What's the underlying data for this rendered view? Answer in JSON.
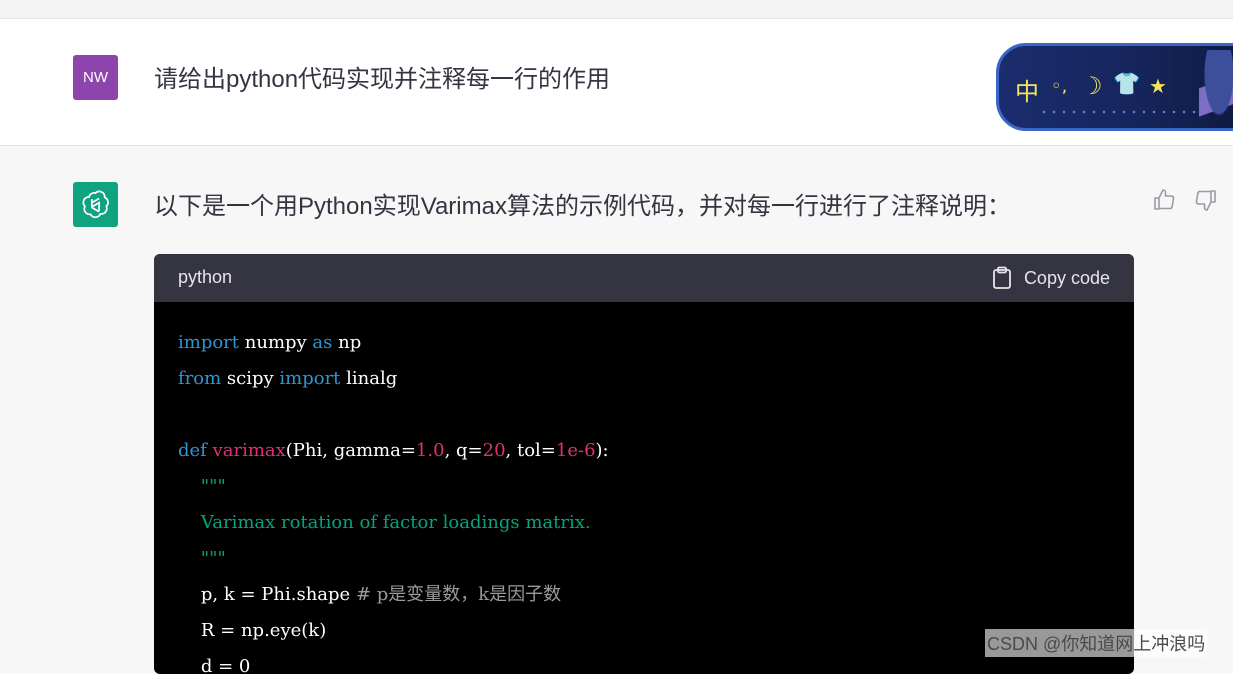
{
  "user_message": {
    "avatar_initials": "NW",
    "text": "请给出python代码实现并注释每一行的作用"
  },
  "ime_toolbar": {
    "items": [
      "中",
      "◦,",
      "☽",
      "👕",
      "★"
    ]
  },
  "assistant_message": {
    "text": "以下是一个用Python实现Varimax算法的示例代码，并对每一行进行了注释说明："
  },
  "code_block": {
    "language": "python",
    "copy_label": "Copy code",
    "tokens": {
      "import": "import",
      "numpy": " numpy ",
      "as": "as",
      "np": " np",
      "from": "from",
      "scipy": " scipy ",
      "import2": "import",
      "linalg": " linalg",
      "def": "def",
      "varimax": " varimax",
      "sig1": "(Phi, gamma=",
      "v1": "1.0",
      "sig2": ", q=",
      "v2": "20",
      "sig3": ", tol=",
      "v3": "1e-6",
      "sig4": "):",
      "doc_open": "    \"\"\"",
      "doc_text": "    Varimax rotation of factor loadings matrix.",
      "doc_close": "    \"\"\"",
      "shape_code": "    p, k = Phi.shape ",
      "shape_comment": "# p是变量数，k是因子数",
      "eye_code": "    R = np.eye(k)",
      "next_code": "    d = 0"
    }
  },
  "colors": {
    "keyword": "#2e95d3",
    "function": "#df3079",
    "number": "#df3079",
    "docstring": "#00a67d",
    "comment": "#9a9a9a",
    "accent_bot": "#10a37f",
    "user_avatar": "#8e44ad"
  },
  "icons": [
    "openai-logo-icon",
    "thumbs-up-icon",
    "thumbs-down-icon",
    "clipboard-icon"
  ],
  "watermark": "CSDN @你知道网上冲浪吗"
}
